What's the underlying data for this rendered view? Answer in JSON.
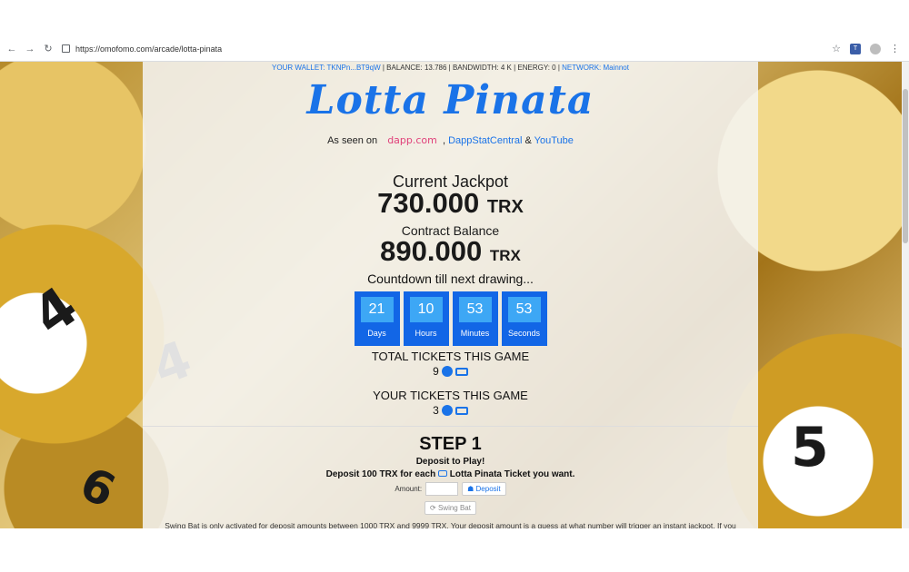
{
  "browser": {
    "url": "https://omofomo.com/arcade/lotta-pinata",
    "back_icon": "arrow-left-icon",
    "forward_icon": "arrow-right-icon",
    "reload_icon": "reload-icon"
  },
  "wallet": {
    "label": "YOUR WALLET: TKNPn...BT9qW",
    "balance": " | BALANCE: 13.786 | BANDWIDTH: 4 K | ENERGY: 0 | ",
    "network": "NETWORK: Mainnot"
  },
  "title": "Lotta Pinata",
  "seen": {
    "prefix": "As seen on",
    "dapp": "dapp.com",
    "sep1": " , ",
    "link1": "DappStatCentral",
    "sep2": " & ",
    "link2": "YouTube"
  },
  "jackpot": {
    "label": "Current Jackpot",
    "value": "730.000",
    "unit": "TRX"
  },
  "contract": {
    "label": "Contract Balance",
    "value": "890.000",
    "unit": "TRX"
  },
  "countdown": {
    "label": "Countdown till next drawing...",
    "items": [
      {
        "value": "21",
        "label": "Days"
      },
      {
        "value": "10",
        "label": "Hours"
      },
      {
        "value": "53",
        "label": "Minutes"
      },
      {
        "value": "53",
        "label": "Seconds"
      }
    ]
  },
  "total_tickets": {
    "label": "TOTAL TICKETS THIS GAME",
    "value": "9"
  },
  "your_tickets": {
    "label": "YOUR TICKETS THIS GAME",
    "value": "3"
  },
  "step": {
    "title": "STEP 1",
    "heading": "Deposit to Play!",
    "sub_pre": "Deposit 100 TRX for each",
    "sub_post": "Lotta Pinata Ticket you want.",
    "amount_label": "Amount:",
    "deposit_button": "Deposit",
    "swing_button": "Swing Bat",
    "fine": "Swing Bat is only activated for deposit amounts between 1000 TRX and 9999 TRX. Your deposit amount is a guess at what number will trigger an instant jackpot. If you guess correct, you will win the Current Jackpot"
  }
}
